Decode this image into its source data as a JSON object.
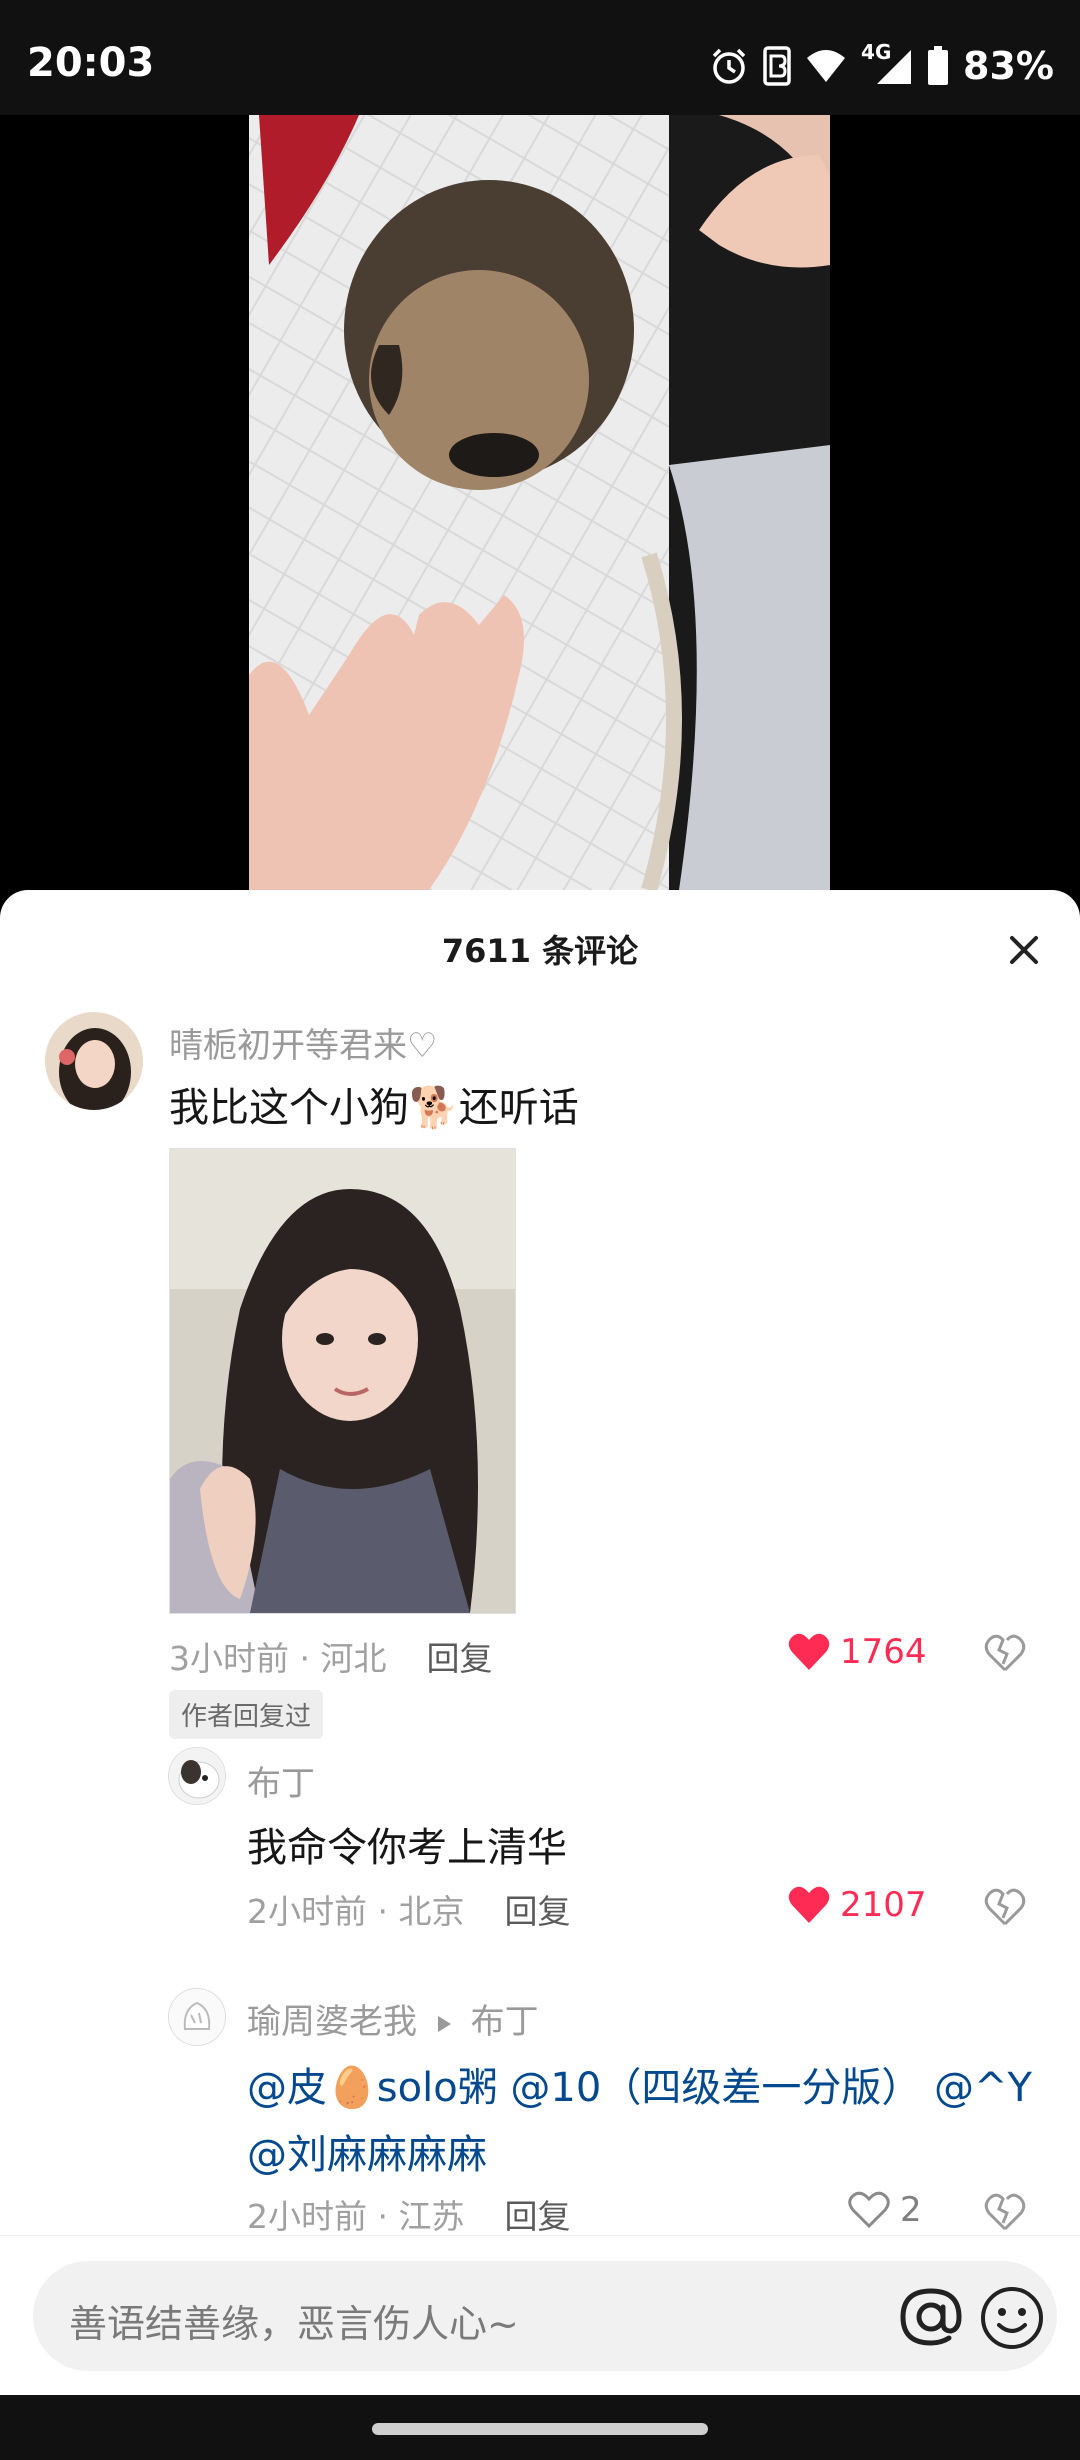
{
  "status_bar": {
    "time": "20:03",
    "network": "4G",
    "battery": "83%",
    "icons": [
      "alarm-icon",
      "data-saver-icon",
      "wifi-icon",
      "signal-icon",
      "battery-icon"
    ]
  },
  "sheet": {
    "title": "7611 条评论"
  },
  "comments": [
    {
      "username": "晴栀初开等君来♡",
      "text": "我比这个小狗🐕还听话",
      "has_image": true,
      "time_location": "3小时前 · 河北",
      "reply_label": "回复",
      "likes": "1764",
      "liked": true,
      "badge": "作者回复过",
      "replies": [
        {
          "username": "布丁",
          "text": "我命令你考上清华",
          "time_location": "2小时前 · 北京",
          "reply_label": "回复",
          "likes": "2107",
          "liked": true
        },
        {
          "username": "瑜周婆老我",
          "reply_to": "布丁",
          "mentions_line1": "@皮🥚solo粥 @10（四级差一分版） @^Y",
          "mentions_line2": "@刘麻麻麻麻",
          "time_location": "2小时前 · 江苏",
          "reply_label": "回复",
          "likes": "2",
          "liked": false
        }
      ]
    }
  ],
  "input": {
    "placeholder": "善语结善缘，恶言伤人心~"
  },
  "colors": {
    "like_active": "#fe2c55",
    "mention": "#04498d"
  }
}
